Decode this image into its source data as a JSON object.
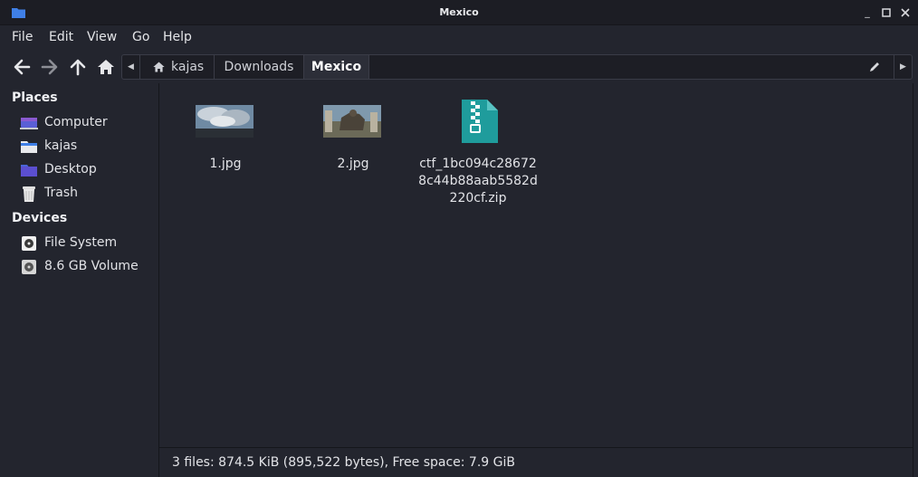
{
  "window": {
    "title": "Mexico"
  },
  "menu": [
    "File",
    "Edit",
    "View",
    "Go",
    "Help"
  ],
  "path": {
    "segments": [
      "kajas",
      "Downloads",
      "Mexico"
    ],
    "active": "Mexico"
  },
  "sidebar": {
    "places_heading": "Places",
    "places": [
      {
        "label": "Computer",
        "icon": "computer-icon"
      },
      {
        "label": "kajas",
        "icon": "home-folder-icon"
      },
      {
        "label": "Desktop",
        "icon": "desktop-icon"
      },
      {
        "label": "Trash",
        "icon": "trash-icon"
      }
    ],
    "devices_heading": "Devices",
    "devices": [
      {
        "label": "File System",
        "icon": "drive-icon"
      },
      {
        "label": "8.6 GB Volume",
        "icon": "drive-icon"
      }
    ]
  },
  "files": [
    {
      "name": "1.jpg",
      "type": "image"
    },
    {
      "name": "2.jpg",
      "type": "image"
    },
    {
      "name": "ctf_1bc094c286728c44b88aab5582d220cf.zip",
      "name_lines": [
        "ctf_1bc094c28672",
        "8c44b88aab5582d",
        "220cf.zip"
      ],
      "type": "archive"
    }
  ],
  "status": "3 files: 874.5 KiB (895,522 bytes), Free space: 7.9 GiB",
  "colors": {
    "accent": "#3f7fe6",
    "zip_icon": "#1f9c9c",
    "background": "#23252e"
  }
}
